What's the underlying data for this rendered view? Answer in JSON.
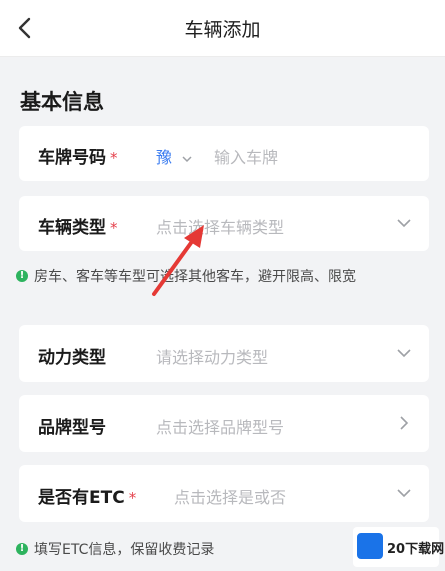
{
  "header": {
    "title": "车辆添加"
  },
  "section": {
    "title": "基本信息"
  },
  "rows": [
    {
      "label": "车牌号码",
      "required": "*",
      "prefix": "豫",
      "placeholder": "输入车牌"
    },
    {
      "label": "车辆类型",
      "required": "*",
      "placeholder": "点击选择车辆类型"
    },
    {
      "label": "动力类型",
      "placeholder": "请选择动力类型"
    },
    {
      "label": "品牌型号",
      "placeholder": "点击选择品牌型号"
    },
    {
      "label": "是否有ETC",
      "required": "*",
      "placeholder": "点击选择是或否"
    }
  ],
  "tips": [
    {
      "icon": "!",
      "text": "房车、客车等车型可选择其他客车，避开限高、限宽"
    },
    {
      "icon": "!",
      "text": "填写ETC信息，保留收费记录"
    }
  ],
  "watermark": {
    "text": "20下载网"
  },
  "colors": {
    "accent": "#3b7cf0",
    "required": "#e5424d",
    "tip": "#2db35e",
    "pointer": "#e53935"
  }
}
